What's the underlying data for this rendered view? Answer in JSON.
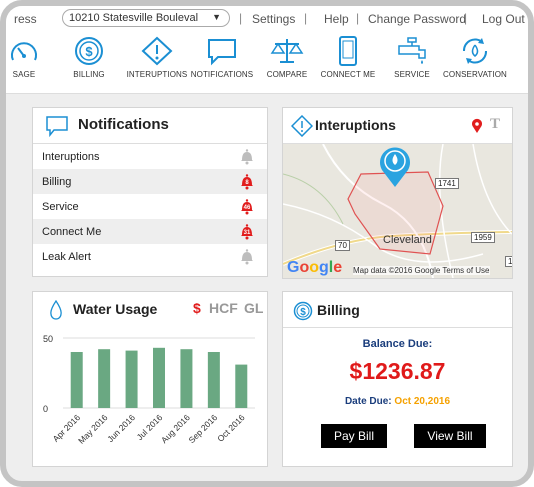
{
  "topbar": {
    "address_label": "ress",
    "address_value": "10210 Statesville Bouleval",
    "links": [
      "Settings",
      "Help",
      "Change Password",
      "Log Out"
    ]
  },
  "nav": {
    "items": [
      {
        "label": "SAGE",
        "icon": "gauge-icon"
      },
      {
        "label": "BILLING",
        "icon": "dollar-icon"
      },
      {
        "label": "INTERUPTIONS",
        "icon": "warning-icon"
      },
      {
        "label": "NOTIFICATIONS",
        "icon": "chat-icon"
      },
      {
        "label": "COMPARE",
        "icon": "scale-icon"
      },
      {
        "label": "CONNECT ME",
        "icon": "phone-icon"
      },
      {
        "label": "SERVICE",
        "icon": "faucet-icon"
      },
      {
        "label": "CONSERVATION",
        "icon": "recycle-drop-icon"
      }
    ],
    "accent": "#1b8fd3"
  },
  "notifications": {
    "title": "Notifications",
    "rows": [
      {
        "label": "Interuptions",
        "count": "",
        "active": false
      },
      {
        "label": "Billing",
        "count": "8",
        "active": true
      },
      {
        "label": "Service",
        "count": "46",
        "active": true
      },
      {
        "label": "Connect Me",
        "count": "31",
        "active": true
      },
      {
        "label": "Leak Alert",
        "count": "",
        "active": false
      }
    ]
  },
  "interuptions": {
    "title": "Interuptions",
    "map": {
      "city": "Cleveland",
      "google": "Google",
      "credit": "Map data ©2016 Google   Terms of Use",
      "route_1741": "1741",
      "route_1959": "1959",
      "route_70": "70",
      "route_1": "1"
    }
  },
  "water_usage": {
    "title": "Water Usage",
    "units": [
      "$",
      "HCF",
      "GL"
    ]
  },
  "billing": {
    "title": "Billing",
    "balance_label": "Balance Due:",
    "balance_amount": "$1236.87",
    "date_label": "Date Due:",
    "date_value": "Oct 20,2016",
    "pay_button": "Pay Bill",
    "view_button": "View Bill"
  },
  "chart_data": {
    "type": "bar",
    "categories": [
      "Apr 2016",
      "May 2016",
      "Jun 2016",
      "Jul 2016",
      "Aug 2016",
      "Sep 2016",
      "Oct 2016"
    ],
    "values": [
      40,
      42,
      41,
      43,
      42,
      40,
      31
    ],
    "ylim": [
      0,
      50
    ],
    "yticks": [
      0,
      50
    ],
    "color": "#6aa882",
    "grid": true
  }
}
